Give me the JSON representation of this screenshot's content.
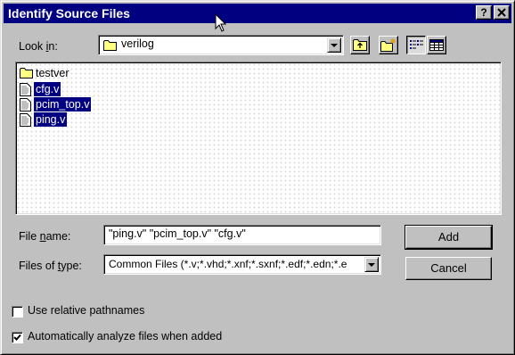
{
  "window": {
    "title": "Identify Source Files",
    "help_label": "?",
    "close_label": "X"
  },
  "lookin": {
    "label_pre": "Look ",
    "label_ul": "i",
    "label_post": "n:",
    "value": "verilog"
  },
  "toolbar": {
    "icons": [
      "up-one-level-icon",
      "create-new-folder-icon",
      "list-view-icon",
      "details-view-icon"
    ]
  },
  "files": [
    {
      "name": "testver",
      "type": "folder",
      "selected": false
    },
    {
      "name": "cfg.v",
      "type": "file",
      "selected": true
    },
    {
      "name": "pcim_top.v",
      "type": "file",
      "selected": true
    },
    {
      "name": "ping.v",
      "type": "file",
      "selected": true
    }
  ],
  "filename": {
    "label_pre": "File ",
    "label_ul": "n",
    "label_post": "ame:",
    "value": "\"ping.v\" \"pcim_top.v\" \"cfg.v\""
  },
  "filetype": {
    "label_pre": "Files of ",
    "label_ul": "t",
    "label_post": "ype:",
    "value": "Common Files (*.v;*.vhd;*.xnf;*.sxnf;*.edf;*.edn;*.e"
  },
  "buttons": {
    "add": "Add",
    "cancel": "Cancel"
  },
  "options": {
    "relative": {
      "label": "Use relative pathnames",
      "checked": false
    },
    "analyze": {
      "label": "Automatically analyze files when added",
      "checked": true
    }
  },
  "colors": {
    "title_bar": "#000080",
    "selection": "#000080",
    "face": "#c0c0c0"
  }
}
